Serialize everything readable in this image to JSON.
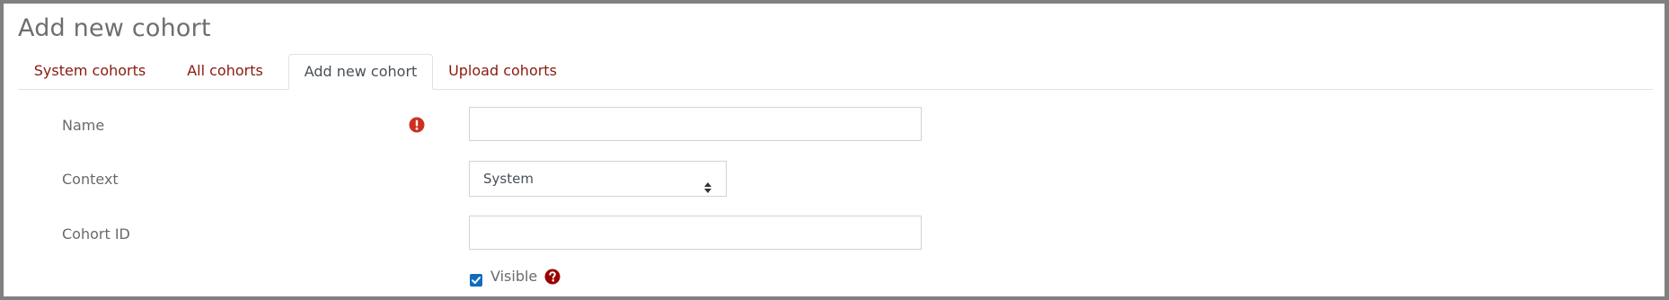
{
  "page": {
    "title": "Add new cohort"
  },
  "tabs": [
    {
      "label": "System cohorts",
      "active": false
    },
    {
      "label": "All cohorts",
      "active": false
    },
    {
      "label": "Add new cohort",
      "active": true
    },
    {
      "label": "Upload cohorts",
      "active": false
    }
  ],
  "form": {
    "name": {
      "label": "Name",
      "value": "",
      "required_icon": "exclamation-circle-icon"
    },
    "context": {
      "label": "Context",
      "selected": "System",
      "caret_icon": "sort-caret-icon"
    },
    "cohort_id": {
      "label": "Cohort ID",
      "value": ""
    },
    "visible": {
      "label": "Visible",
      "checked": true,
      "help_icon": "question-circle-icon"
    }
  },
  "colors": {
    "link": "#8a1a0e",
    "required": "#ca3120",
    "help": "#990000",
    "checkbox": "#0f6cbf",
    "frame": "#808080"
  }
}
